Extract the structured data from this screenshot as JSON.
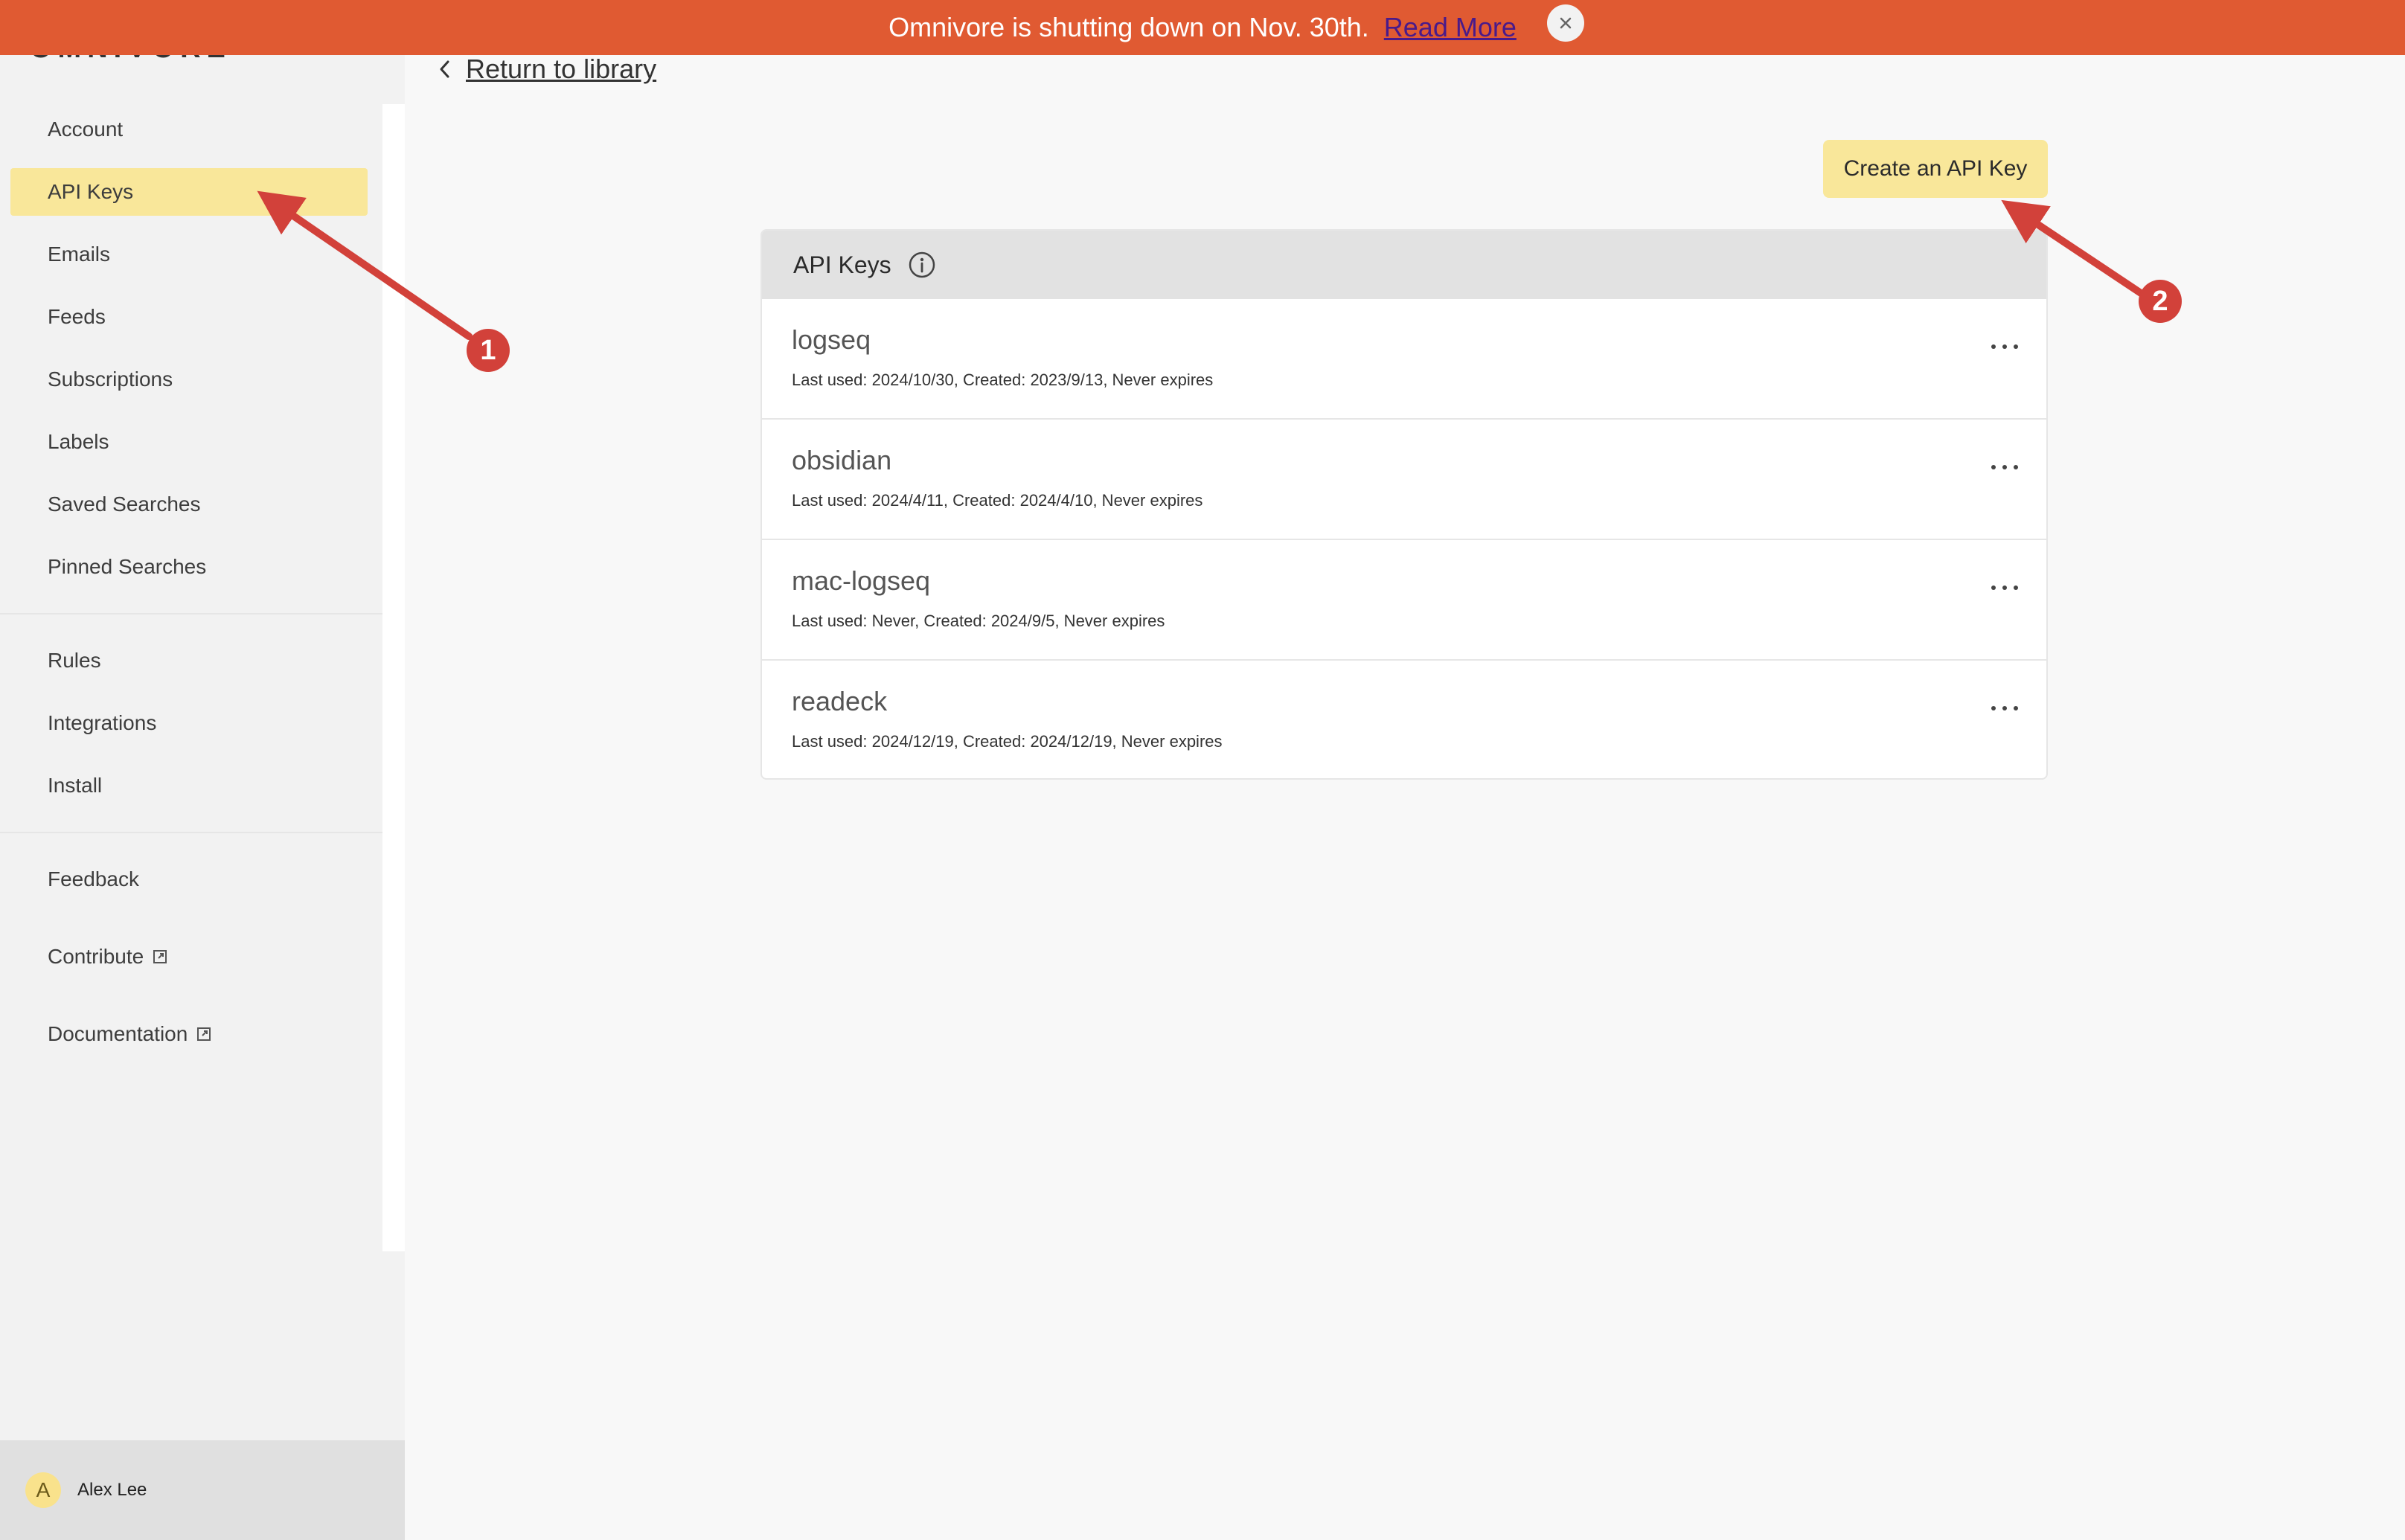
{
  "banner": {
    "message": "Omnivore is shutting down on Nov. 30th.",
    "link_label": "Read More",
    "close_icon": "close-icon"
  },
  "sidebar": {
    "logo_text": "OMNIVORE",
    "items": [
      {
        "label": "Account"
      },
      {
        "label": "API Keys",
        "active": true
      },
      {
        "label": "Emails"
      },
      {
        "label": "Feeds"
      },
      {
        "label": "Subscriptions"
      },
      {
        "label": "Labels"
      },
      {
        "label": "Saved Searches"
      },
      {
        "label": "Pinned Searches"
      },
      {
        "label": "Rules"
      },
      {
        "label": "Integrations"
      },
      {
        "label": "Install"
      },
      {
        "label": "Feedback"
      },
      {
        "label": "Contribute",
        "icon": "external-link-icon"
      },
      {
        "label": "Documentation",
        "icon": "external-link-icon"
      }
    ],
    "user": {
      "initial": "A",
      "name": "Alex Lee"
    }
  },
  "main": {
    "back_label": "Return to library",
    "create_button_label": "Create an API Key",
    "panel": {
      "title": "API Keys",
      "info_icon": "info-icon",
      "keys": [
        {
          "name": "logseq",
          "meta": "Last used: 2024/10/30, Created: 2023/9/13, Never expires"
        },
        {
          "name": "obsidian",
          "meta": "Last used: 2024/4/11, Created: 2024/4/10, Never expires"
        },
        {
          "name": "mac-logseq",
          "meta": "Last used: Never, Created: 2024/9/5, Never expires"
        },
        {
          "name": "readeck",
          "meta": "Last used: 2024/12/19, Created: 2024/12/19, Never expires"
        }
      ]
    }
  },
  "annotations": [
    {
      "label": "1"
    },
    {
      "label": "2"
    }
  ],
  "colors": {
    "banner": "#e05a32",
    "accent": "#f9e79a",
    "annotation": "#d2413a"
  }
}
